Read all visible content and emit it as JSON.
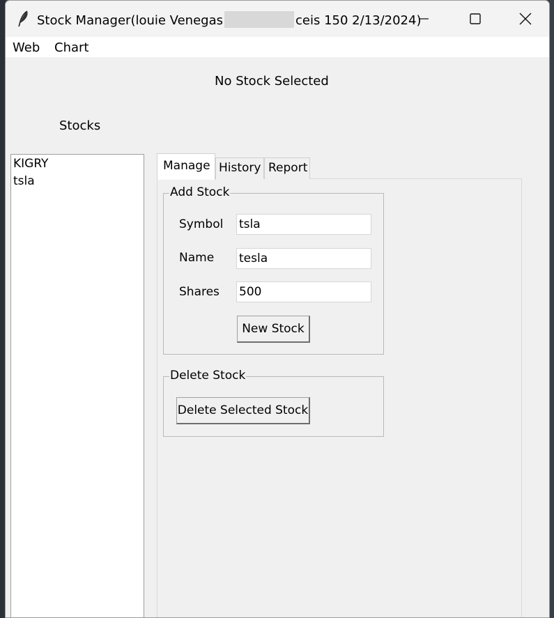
{
  "window": {
    "title_prefix": "Stock Manager(louie Venegas",
    "title_suffix": "ceis 150 2/13/2024)"
  },
  "menu": {
    "items": [
      "Web",
      "Chart"
    ]
  },
  "status": {
    "selected_label": "No Stock Selected"
  },
  "stocks": {
    "label": "Stocks",
    "items": [
      "KIGRY",
      "tsla"
    ]
  },
  "tabs": [
    {
      "label": "Manage",
      "active": true
    },
    {
      "label": "History",
      "active": false
    },
    {
      "label": "Report",
      "active": false
    }
  ],
  "add_stock": {
    "legend": "Add Stock",
    "symbol_label": "Symbol",
    "symbol_value": "tsla",
    "name_label": "Name",
    "name_value": "tesla",
    "shares_label": "Shares",
    "shares_value": "500",
    "button_label": "New Stock"
  },
  "delete_stock": {
    "legend": "Delete Stock",
    "button_label": "Delete Selected Stock"
  },
  "icons": {
    "app": "feather-icon",
    "minimize": "minimize-icon",
    "maximize": "maximize-icon",
    "close": "close-icon"
  }
}
